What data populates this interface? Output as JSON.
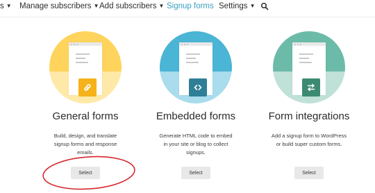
{
  "nav": {
    "items": [
      {
        "label": "s",
        "has_caret": true
      },
      {
        "label": "Manage subscribers",
        "has_caret": true
      },
      {
        "label": "Add subscribers",
        "has_caret": true
      },
      {
        "label": "Signup forms",
        "has_caret": false,
        "active": true
      },
      {
        "label": "Settings",
        "has_caret": true
      }
    ],
    "search_icon": "search-icon"
  },
  "cards": [
    {
      "title": "General forms",
      "description": "Build, design, and translate signup forms and response emails.",
      "button": "Select",
      "icon": "link-icon",
      "colors": {
        "top": "#ffd45c",
        "bottom": "#ffe9a8",
        "badge": "#f6b21a"
      }
    },
    {
      "title": "Embedded forms",
      "description": "Generate HTML code to embed in your site or blog to collect signups.",
      "button": "Select",
      "icon": "code-icon",
      "colors": {
        "top": "#4ab5d5",
        "bottom": "#a9dcec",
        "badge": "#2e7f97"
      }
    },
    {
      "title": "Form integrations",
      "description": "Add a signup form to WordPress or build super custom forms.",
      "button": "Select",
      "icon": "swap-arrows-icon",
      "colors": {
        "top": "#6cbba8",
        "bottom": "#bfe1d8",
        "badge": "#3d8a73"
      }
    }
  ],
  "annotation": {
    "color": "#d6282e"
  }
}
